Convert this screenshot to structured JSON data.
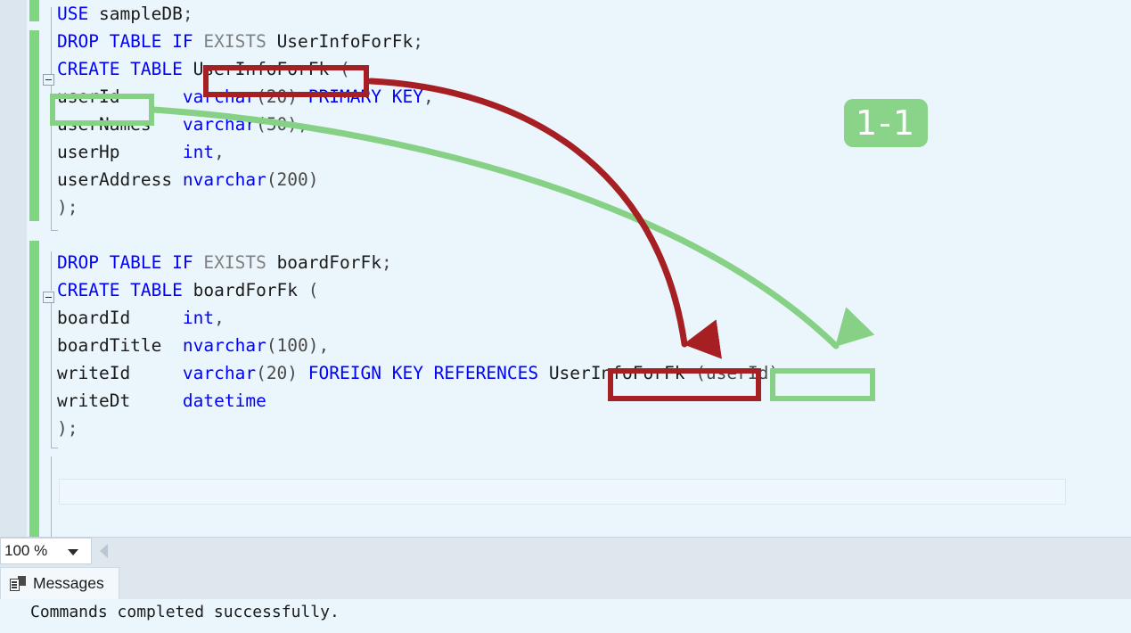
{
  "editor": {
    "zoom_level": "100 %",
    "lines": [
      {
        "n": 1,
        "tokens": [
          {
            "t": "USE",
            "c": "kw"
          },
          {
            "t": " sampleDB",
            "c": "idn"
          },
          {
            "t": ";",
            "c": "pun"
          }
        ]
      },
      {
        "n": 2,
        "tokens": [
          {
            "t": "DROP TABLE IF",
            "c": "kw"
          },
          {
            "t": " ",
            "c": "idn"
          },
          {
            "t": "EXISTS",
            "c": "gry"
          },
          {
            "t": " UserInfoForFk",
            "c": "idn"
          },
          {
            "t": ";",
            "c": "pun"
          }
        ]
      },
      {
        "n": 3,
        "tokens": [
          {
            "t": "CREATE TABLE",
            "c": "kw"
          },
          {
            "t": " UserInfoForFk ",
            "c": "idn"
          },
          {
            "t": "(",
            "c": "pun"
          }
        ]
      },
      {
        "n": 4,
        "tokens": [
          {
            "t": "userId      ",
            "c": "idn"
          },
          {
            "t": "varchar",
            "c": "typ"
          },
          {
            "t": "(20)",
            "c": "pun"
          },
          {
            "t": " ",
            "c": "idn"
          },
          {
            "t": "PRIMARY KEY",
            "c": "kw"
          },
          {
            "t": ",",
            "c": "pun"
          }
        ]
      },
      {
        "n": 5,
        "tokens": [
          {
            "t": "userNames   ",
            "c": "idn"
          },
          {
            "t": "varchar",
            "c": "typ"
          },
          {
            "t": "(50)",
            "c": "pun"
          },
          {
            "t": ",",
            "c": "pun"
          }
        ]
      },
      {
        "n": 6,
        "tokens": [
          {
            "t": "userHp      ",
            "c": "idn"
          },
          {
            "t": "int",
            "c": "typ"
          },
          {
            "t": ",",
            "c": "pun"
          }
        ]
      },
      {
        "n": 7,
        "tokens": [
          {
            "t": "userAddress ",
            "c": "idn"
          },
          {
            "t": "nvarchar",
            "c": "typ"
          },
          {
            "t": "(200)",
            "c": "pun"
          }
        ]
      },
      {
        "n": 8,
        "tokens": [
          {
            "t": ");",
            "c": "pun"
          }
        ]
      },
      {
        "n": 9,
        "tokens": []
      },
      {
        "n": 10,
        "tokens": [
          {
            "t": "DROP TABLE IF",
            "c": "kw"
          },
          {
            "t": " ",
            "c": "idn"
          },
          {
            "t": "EXISTS",
            "c": "gry"
          },
          {
            "t": " boardForFk",
            "c": "idn"
          },
          {
            "t": ";",
            "c": "pun"
          }
        ]
      },
      {
        "n": 11,
        "tokens": [
          {
            "t": "CREATE TABLE",
            "c": "kw"
          },
          {
            "t": " boardForFk ",
            "c": "idn"
          },
          {
            "t": "(",
            "c": "pun"
          }
        ]
      },
      {
        "n": 12,
        "tokens": [
          {
            "t": "boardId     ",
            "c": "idn"
          },
          {
            "t": "int",
            "c": "typ"
          },
          {
            "t": ",",
            "c": "pun"
          }
        ]
      },
      {
        "n": 13,
        "tokens": [
          {
            "t": "boardTitle  ",
            "c": "idn"
          },
          {
            "t": "nvarchar",
            "c": "typ"
          },
          {
            "t": "(100)",
            "c": "pun"
          },
          {
            "t": ",",
            "c": "pun"
          }
        ]
      },
      {
        "n": 14,
        "tokens": [
          {
            "t": "writeId     ",
            "c": "idn"
          },
          {
            "t": "varchar",
            "c": "typ"
          },
          {
            "t": "(20)",
            "c": "pun"
          },
          {
            "t": " ",
            "c": "idn"
          },
          {
            "t": "FOREIGN KEY REFERENCES",
            "c": "kw"
          },
          {
            "t": " UserInfoForFk ",
            "c": "idn"
          },
          {
            "t": "(userId)",
            "c": "pun"
          }
        ]
      },
      {
        "n": 15,
        "tokens": [
          {
            "t": "writeDt     ",
            "c": "idn"
          },
          {
            "t": "datetime",
            "c": "typ"
          }
        ]
      },
      {
        "n": 16,
        "tokens": [
          {
            "t": ");",
            "c": "pun"
          }
        ]
      }
    ]
  },
  "annotations": {
    "relation_badge": "1-1",
    "colors": {
      "table_highlight": "#a51f23",
      "column_highlight": "#86d186",
      "badge_bg": "#8ad48a",
      "badge_text": "#ffffff"
    },
    "boxes": [
      {
        "name": "table-name-declaration",
        "text": "UserInfoForFk",
        "color": "red"
      },
      {
        "name": "primary-key-column",
        "text": "userId",
        "color": "green"
      },
      {
        "name": "referenced-table-name",
        "text": "UserInfoForFk",
        "color": "red"
      },
      {
        "name": "referenced-column-name",
        "text": "(userId)",
        "color": "green"
      }
    ]
  },
  "results": {
    "tab_label": "Messages",
    "tab_icon": "messages-icon",
    "message": "Commands completed successfully."
  }
}
